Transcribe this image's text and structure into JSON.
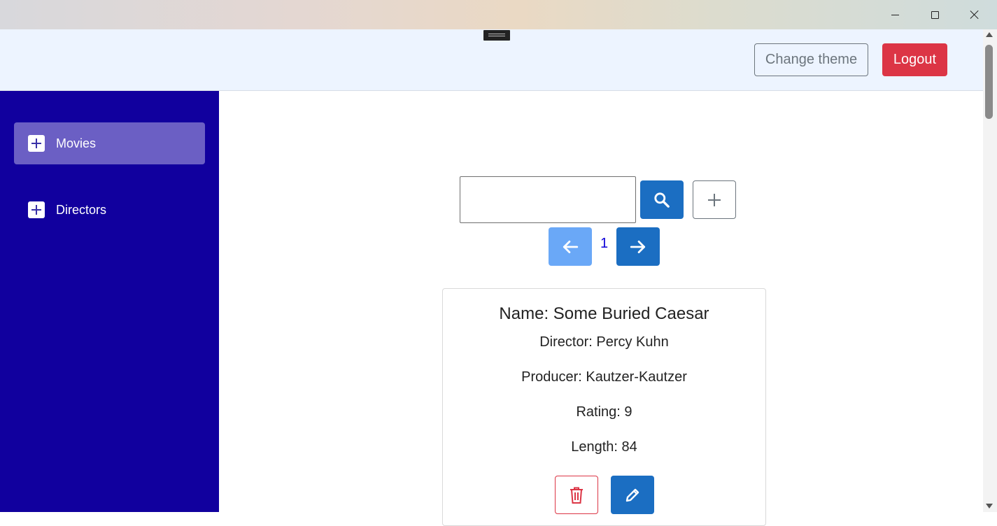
{
  "header": {
    "change_theme_label": "Change theme",
    "logout_label": "Logout"
  },
  "sidebar": {
    "items": [
      {
        "label": "Movies",
        "active": true,
        "icon": "plus-icon"
      },
      {
        "label": "Directors",
        "active": false,
        "icon": "plus-icon"
      }
    ]
  },
  "search": {
    "value": "",
    "placeholder": ""
  },
  "pagination": {
    "current_page": "1"
  },
  "movie": {
    "name": "Name: Some Buried Caesar",
    "director": "Director: Percy Kuhn",
    "producer": "Producer: Kautzer-Kautzer",
    "rating": "Rating: 9",
    "length": "Length: 84"
  },
  "colors": {
    "sidebar_bg": "#11009e",
    "active_item": "#6b5fc4",
    "primary": "#1b6ec2",
    "primary_disabled": "#6aa8f7",
    "danger": "#dc3545",
    "topbar_bg": "#edf4ff"
  }
}
